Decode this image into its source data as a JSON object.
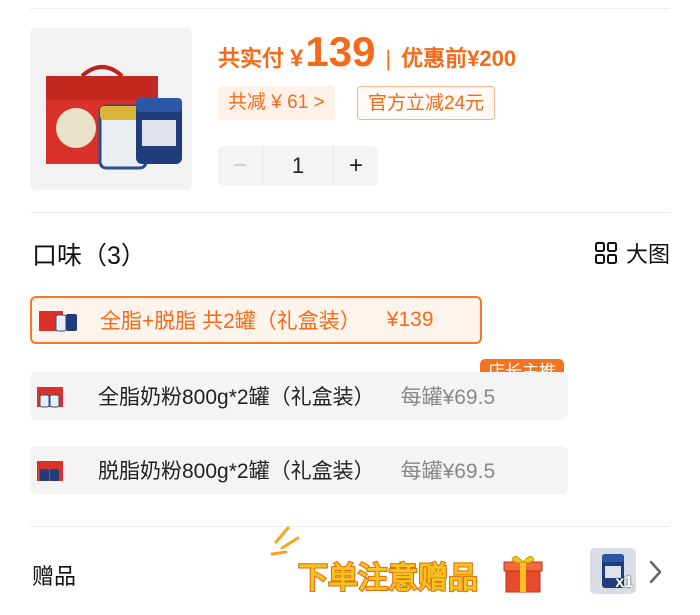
{
  "price": {
    "total_label": "共实付",
    "currency": "¥",
    "amount": "139",
    "separator": "|",
    "original_label": "优惠前",
    "original_price": "¥200"
  },
  "discounts": {
    "total_discount": "共减 ¥ 61 >",
    "official_discount": "官方立减24元"
  },
  "quantity": {
    "minus": "−",
    "value": "1",
    "plus": "+"
  },
  "flavor": {
    "title": "口味（3）",
    "big_view_label": "大图",
    "options": [
      {
        "name": "全脂+脱脂 共2罐（礼盒装）",
        "price": "¥139",
        "selected": true
      },
      {
        "name": "全脂奶粉800g*2罐（礼盒装）",
        "price": "每罐¥69.5",
        "selected": false
      },
      {
        "name": "脱脂奶粉800g*2罐（礼盒装）",
        "price": "每罐¥69.5",
        "selected": false
      }
    ],
    "badge": "店长主推"
  },
  "gift": {
    "label": "赠品",
    "promo": "下单注意赠品",
    "count": "x1"
  },
  "colors": {
    "accent": "#f46a18",
    "badge": "#f5731f",
    "option_bg": "#f4f4f4"
  }
}
